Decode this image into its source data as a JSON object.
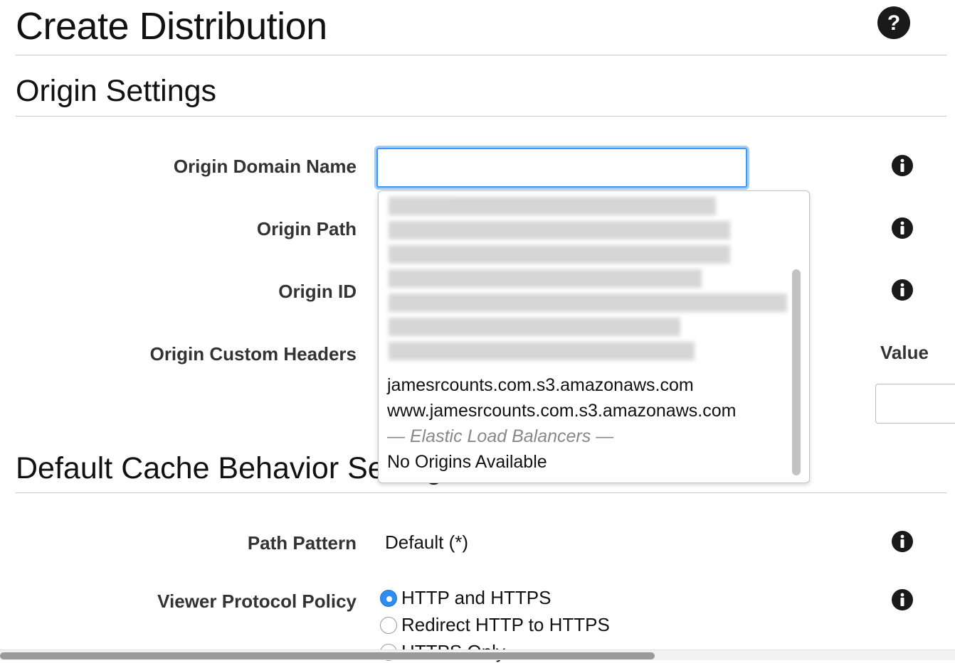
{
  "header": {
    "title": "Create Distribution"
  },
  "origin_settings": {
    "title": "Origin Settings",
    "fields": {
      "origin_domain_name": {
        "label": "Origin Domain Name",
        "value": ""
      },
      "origin_path": {
        "label": "Origin Path"
      },
      "origin_id": {
        "label": "Origin ID"
      },
      "origin_custom_headers": {
        "label": "Origin Custom Headers",
        "value_label": "Value"
      }
    },
    "dropdown": {
      "items": [
        "jamesrcounts.com.s3.amazonaws.com",
        "www.jamesrcounts.com.s3.amazonaws.com"
      ],
      "group_header": "— Elastic Load Balancers —",
      "empty_text": "No Origins Available"
    }
  },
  "cache_behavior": {
    "title": "Default Cache Behavior Settings",
    "path_pattern": {
      "label": "Path Pattern",
      "value": "Default (*)"
    },
    "viewer_protocol_policy": {
      "label": "Viewer Protocol Policy",
      "options": [
        {
          "label": "HTTP and HTTPS",
          "selected": true
        },
        {
          "label": "Redirect HTTP to HTTPS",
          "selected": false
        },
        {
          "label": "HTTPS Only",
          "selected": false
        }
      ]
    }
  },
  "colors": {
    "focus_blue": "#3b99fc",
    "radio_selected": "#2d8ef0",
    "rule_gray": "#c8c8c8"
  },
  "icons": {
    "help": "question-circle-icon",
    "info": "info-circle-icon"
  }
}
